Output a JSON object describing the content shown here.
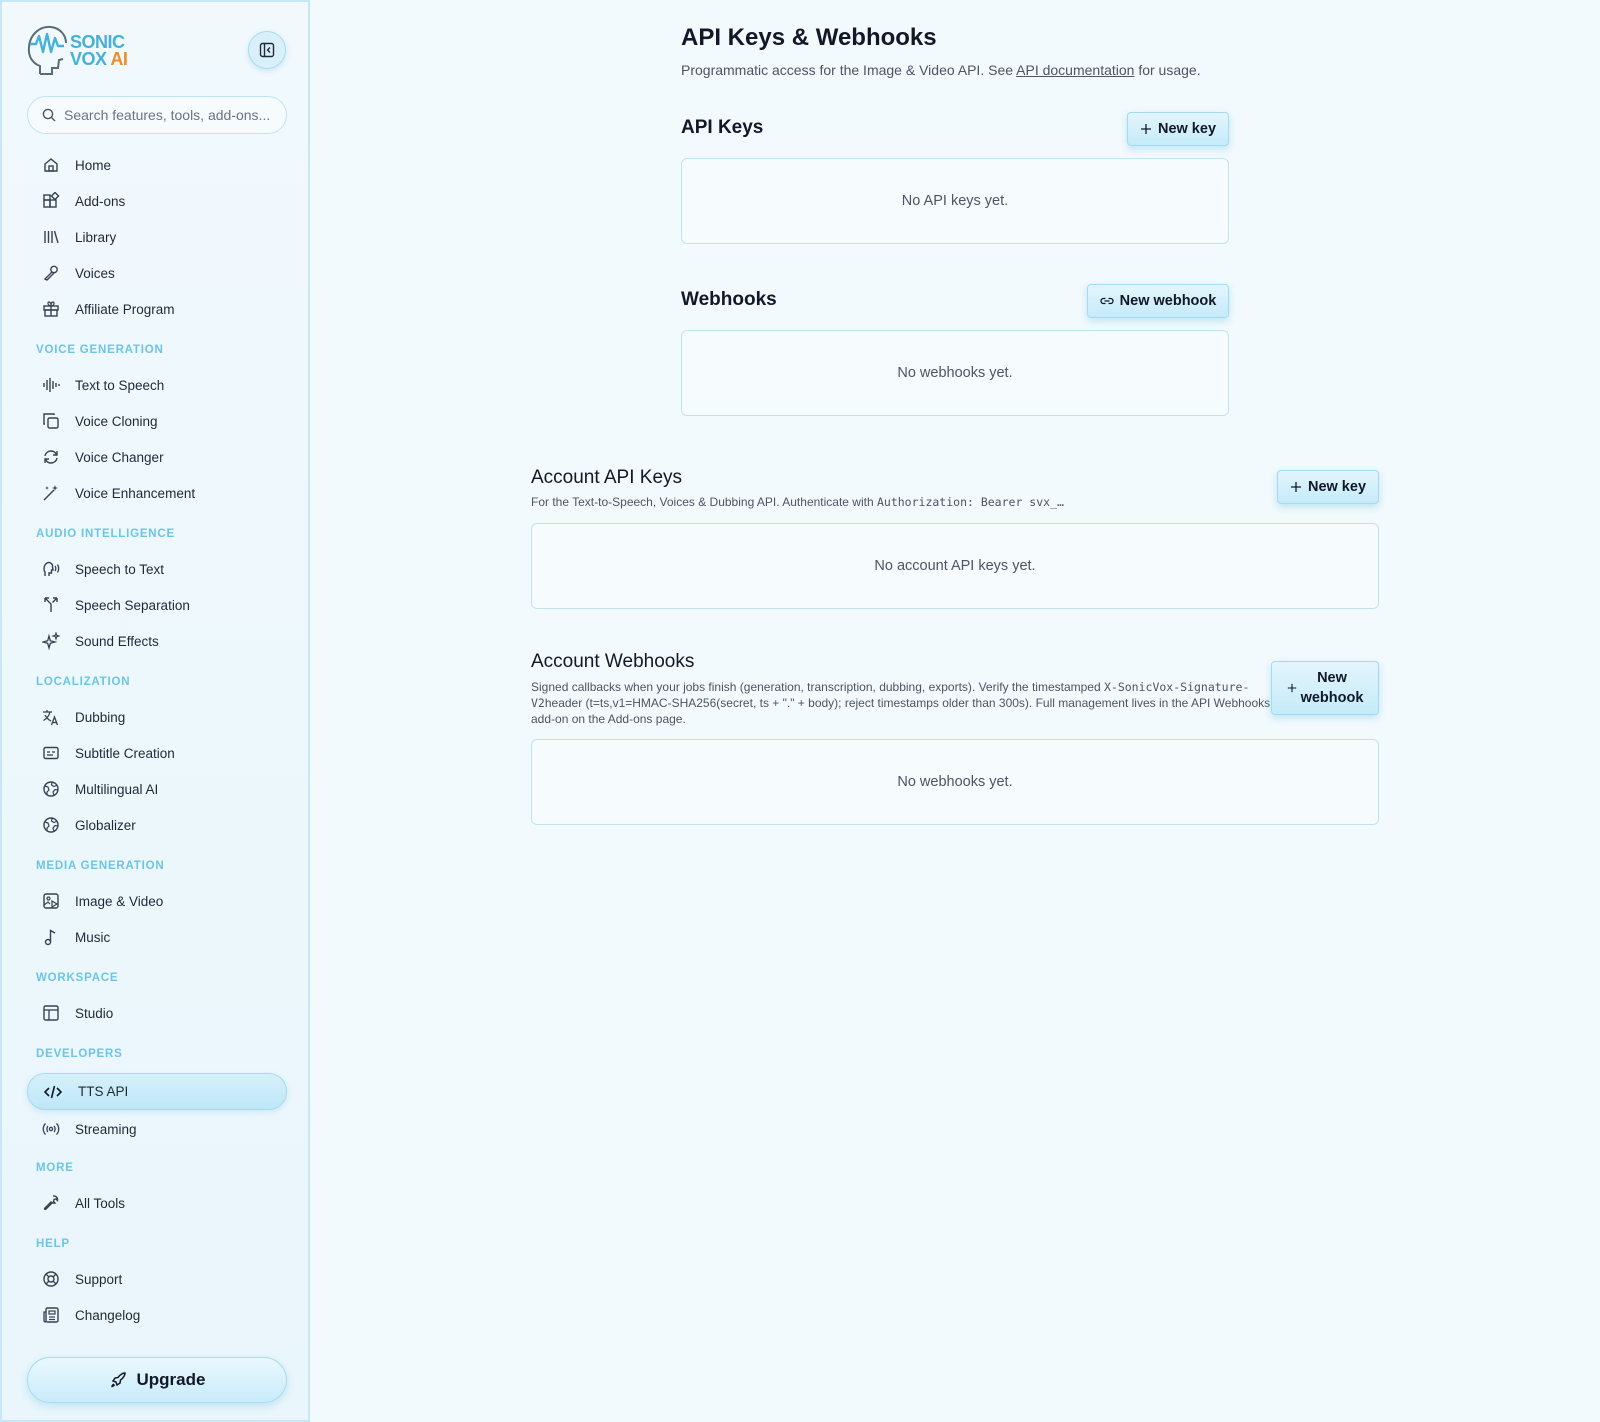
{
  "brand": {
    "line1": "SONIC",
    "line2": "VOX",
    "ai": "AI"
  },
  "search": {
    "placeholder": "Search features, tools, add-ons..."
  },
  "nav": {
    "top": [
      {
        "label": "Home",
        "icon": "home-icon"
      },
      {
        "label": "Add-ons",
        "icon": "puzzle-icon"
      },
      {
        "label": "Library",
        "icon": "library-icon"
      },
      {
        "label": "Voices",
        "icon": "microphone-icon"
      },
      {
        "label": "Affiliate Program",
        "icon": "gift-icon"
      }
    ],
    "sections": [
      {
        "title": "VOICE GENERATION",
        "items": [
          {
            "label": "Text to Speech",
            "icon": "waveform-icon"
          },
          {
            "label": "Voice Cloning",
            "icon": "copy-icon"
          },
          {
            "label": "Voice Changer",
            "icon": "refresh-icon"
          },
          {
            "label": "Voice Enhancement",
            "icon": "magic-wand-icon"
          }
        ]
      },
      {
        "title": "AUDIO INTELLIGENCE",
        "items": [
          {
            "label": "Speech to Text",
            "icon": "speech-icon"
          },
          {
            "label": "Speech Separation",
            "icon": "split-icon"
          },
          {
            "label": "Sound Effects",
            "icon": "sparkles-icon"
          }
        ]
      },
      {
        "title": "LOCALIZATION",
        "items": [
          {
            "label": "Dubbing",
            "icon": "translate-icon"
          },
          {
            "label": "Subtitle Creation",
            "icon": "subtitles-icon"
          },
          {
            "label": "Multilingual AI",
            "icon": "globe-icon"
          },
          {
            "label": "Globalizer",
            "icon": "globe-icon"
          }
        ]
      },
      {
        "title": "MEDIA GENERATION",
        "items": [
          {
            "label": "Image & Video",
            "icon": "image-video-icon"
          },
          {
            "label": "Music",
            "icon": "music-note-icon"
          }
        ]
      },
      {
        "title": "WORKSPACE",
        "items": [
          {
            "label": "Studio",
            "icon": "layout-icon"
          }
        ]
      },
      {
        "title": "DEVELOPERS",
        "items": [
          {
            "label": "TTS API",
            "icon": "code-icon",
            "active": true
          },
          {
            "label": "Streaming",
            "icon": "broadcast-icon"
          }
        ]
      },
      {
        "title": "MORE",
        "items": [
          {
            "label": "All Tools",
            "icon": "wrench-icon"
          }
        ]
      },
      {
        "title": "HELP",
        "items": [
          {
            "label": "Support",
            "icon": "lifebuoy-icon"
          },
          {
            "label": "Changelog",
            "icon": "newspaper-icon"
          }
        ]
      }
    ],
    "upgrade_label": "Upgrade"
  },
  "page": {
    "title": "API Keys & Webhooks",
    "subtitle_pre": "Programmatic access for the Image & Video API. See ",
    "subtitle_link": "API documentation",
    "subtitle_post": " for usage."
  },
  "api_keys": {
    "title": "API Keys",
    "button": "New key",
    "empty": "No API keys yet."
  },
  "webhooks": {
    "title": "Webhooks",
    "button": "New webhook",
    "empty": "No webhooks yet."
  },
  "account_keys": {
    "title": "Account API Keys",
    "desc_pre": "For the Text-to-Speech, Voices & Dubbing API. Authenticate with ",
    "desc_code": "Authorization: Bearer svx_…",
    "button": "New key",
    "empty": "No account API keys yet."
  },
  "account_webhooks": {
    "title": "Account Webhooks",
    "desc_pre": "Signed callbacks when your jobs finish (generation, transcription, dubbing, exports). Verify the timestamped ",
    "desc_code": "X-SonicVox-Signature-V2",
    "desc_post": "header (t=ts,v1=HMAC-SHA256(secret, ts + \".\" + body); reject timestamps older than 300s). Full management lives in the API Webhooks add-on on the Add-ons page.",
    "button_line1": "New",
    "button_line2": "webhook",
    "empty": "No webhooks yet."
  }
}
